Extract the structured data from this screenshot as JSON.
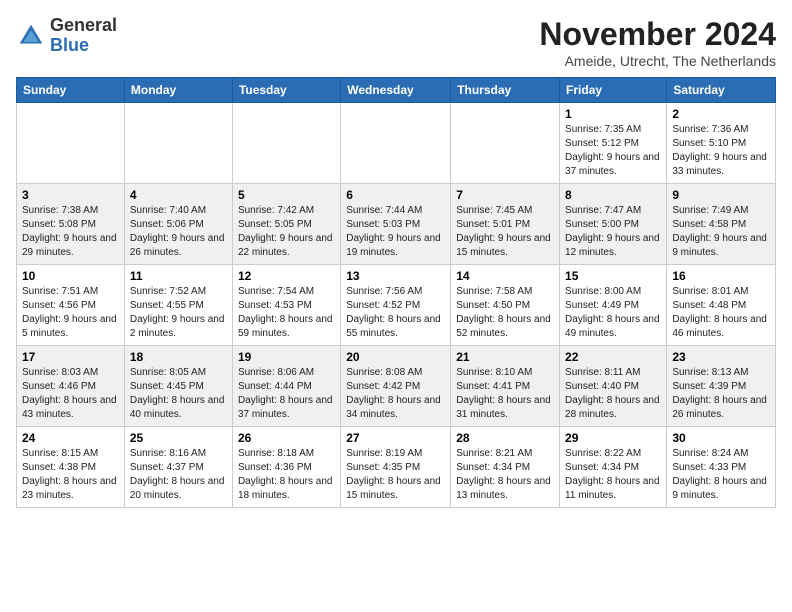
{
  "logo": {
    "general": "General",
    "blue": "Blue"
  },
  "header": {
    "title": "November 2024",
    "location": "Ameide, Utrecht, The Netherlands"
  },
  "days_of_week": [
    "Sunday",
    "Monday",
    "Tuesday",
    "Wednesday",
    "Thursday",
    "Friday",
    "Saturday"
  ],
  "weeks": [
    [
      {
        "day": "",
        "info": ""
      },
      {
        "day": "",
        "info": ""
      },
      {
        "day": "",
        "info": ""
      },
      {
        "day": "",
        "info": ""
      },
      {
        "day": "",
        "info": ""
      },
      {
        "day": "1",
        "info": "Sunrise: 7:35 AM\nSunset: 5:12 PM\nDaylight: 9 hours and 37 minutes."
      },
      {
        "day": "2",
        "info": "Sunrise: 7:36 AM\nSunset: 5:10 PM\nDaylight: 9 hours and 33 minutes."
      }
    ],
    [
      {
        "day": "3",
        "info": "Sunrise: 7:38 AM\nSunset: 5:08 PM\nDaylight: 9 hours and 29 minutes."
      },
      {
        "day": "4",
        "info": "Sunrise: 7:40 AM\nSunset: 5:06 PM\nDaylight: 9 hours and 26 minutes."
      },
      {
        "day": "5",
        "info": "Sunrise: 7:42 AM\nSunset: 5:05 PM\nDaylight: 9 hours and 22 minutes."
      },
      {
        "day": "6",
        "info": "Sunrise: 7:44 AM\nSunset: 5:03 PM\nDaylight: 9 hours and 19 minutes."
      },
      {
        "day": "7",
        "info": "Sunrise: 7:45 AM\nSunset: 5:01 PM\nDaylight: 9 hours and 15 minutes."
      },
      {
        "day": "8",
        "info": "Sunrise: 7:47 AM\nSunset: 5:00 PM\nDaylight: 9 hours and 12 minutes."
      },
      {
        "day": "9",
        "info": "Sunrise: 7:49 AM\nSunset: 4:58 PM\nDaylight: 9 hours and 9 minutes."
      }
    ],
    [
      {
        "day": "10",
        "info": "Sunrise: 7:51 AM\nSunset: 4:56 PM\nDaylight: 9 hours and 5 minutes."
      },
      {
        "day": "11",
        "info": "Sunrise: 7:52 AM\nSunset: 4:55 PM\nDaylight: 9 hours and 2 minutes."
      },
      {
        "day": "12",
        "info": "Sunrise: 7:54 AM\nSunset: 4:53 PM\nDaylight: 8 hours and 59 minutes."
      },
      {
        "day": "13",
        "info": "Sunrise: 7:56 AM\nSunset: 4:52 PM\nDaylight: 8 hours and 55 minutes."
      },
      {
        "day": "14",
        "info": "Sunrise: 7:58 AM\nSunset: 4:50 PM\nDaylight: 8 hours and 52 minutes."
      },
      {
        "day": "15",
        "info": "Sunrise: 8:00 AM\nSunset: 4:49 PM\nDaylight: 8 hours and 49 minutes."
      },
      {
        "day": "16",
        "info": "Sunrise: 8:01 AM\nSunset: 4:48 PM\nDaylight: 8 hours and 46 minutes."
      }
    ],
    [
      {
        "day": "17",
        "info": "Sunrise: 8:03 AM\nSunset: 4:46 PM\nDaylight: 8 hours and 43 minutes."
      },
      {
        "day": "18",
        "info": "Sunrise: 8:05 AM\nSunset: 4:45 PM\nDaylight: 8 hours and 40 minutes."
      },
      {
        "day": "19",
        "info": "Sunrise: 8:06 AM\nSunset: 4:44 PM\nDaylight: 8 hours and 37 minutes."
      },
      {
        "day": "20",
        "info": "Sunrise: 8:08 AM\nSunset: 4:42 PM\nDaylight: 8 hours and 34 minutes."
      },
      {
        "day": "21",
        "info": "Sunrise: 8:10 AM\nSunset: 4:41 PM\nDaylight: 8 hours and 31 minutes."
      },
      {
        "day": "22",
        "info": "Sunrise: 8:11 AM\nSunset: 4:40 PM\nDaylight: 8 hours and 28 minutes."
      },
      {
        "day": "23",
        "info": "Sunrise: 8:13 AM\nSunset: 4:39 PM\nDaylight: 8 hours and 26 minutes."
      }
    ],
    [
      {
        "day": "24",
        "info": "Sunrise: 8:15 AM\nSunset: 4:38 PM\nDaylight: 8 hours and 23 minutes."
      },
      {
        "day": "25",
        "info": "Sunrise: 8:16 AM\nSunset: 4:37 PM\nDaylight: 8 hours and 20 minutes."
      },
      {
        "day": "26",
        "info": "Sunrise: 8:18 AM\nSunset: 4:36 PM\nDaylight: 8 hours and 18 minutes."
      },
      {
        "day": "27",
        "info": "Sunrise: 8:19 AM\nSunset: 4:35 PM\nDaylight: 8 hours and 15 minutes."
      },
      {
        "day": "28",
        "info": "Sunrise: 8:21 AM\nSunset: 4:34 PM\nDaylight: 8 hours and 13 minutes."
      },
      {
        "day": "29",
        "info": "Sunrise: 8:22 AM\nSunset: 4:34 PM\nDaylight: 8 hours and 11 minutes."
      },
      {
        "day": "30",
        "info": "Sunrise: 8:24 AM\nSunset: 4:33 PM\nDaylight: 8 hours and 9 minutes."
      }
    ]
  ]
}
